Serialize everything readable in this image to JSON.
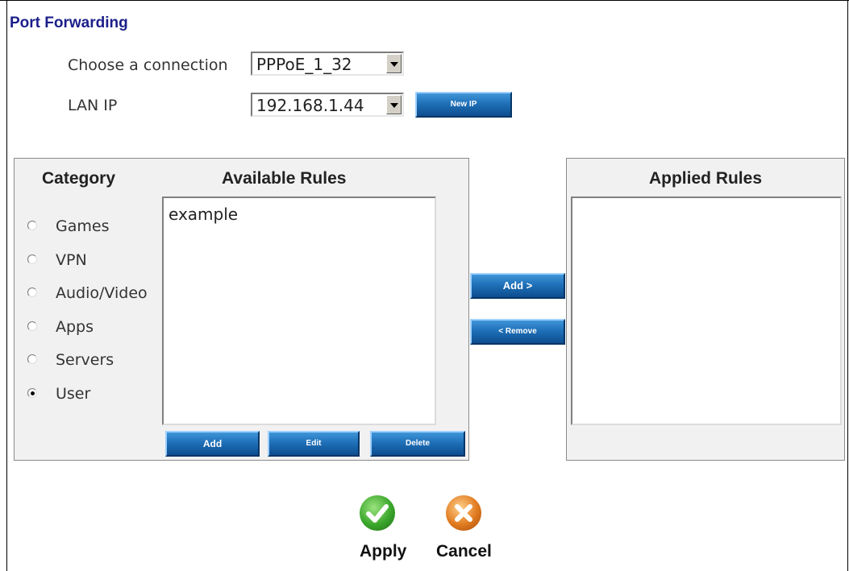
{
  "page": {
    "title": "Port Forwarding"
  },
  "connection": {
    "label": "Choose a connection",
    "value": "PPPoE_1_32"
  },
  "lan": {
    "label": "LAN IP",
    "value": "192.168.1.44",
    "new_ip_button": "New IP"
  },
  "left_panel": {
    "category_heading": "Category",
    "available_heading": "Available Rules",
    "categories": [
      {
        "label": "Games",
        "selected": false
      },
      {
        "label": "VPN",
        "selected": false
      },
      {
        "label": "Audio/Video",
        "selected": false
      },
      {
        "label": "Apps",
        "selected": false
      },
      {
        "label": "Servers",
        "selected": false
      },
      {
        "label": "User",
        "selected": true
      }
    ],
    "available_rules": [
      "example"
    ],
    "buttons": {
      "add": "Add",
      "edit": "Edit",
      "delete": "Delete"
    }
  },
  "transfer": {
    "add": "Add >",
    "remove": "< Remove"
  },
  "right_panel": {
    "heading": "Applied Rules",
    "applied_rules": []
  },
  "footer": {
    "apply": "Apply",
    "cancel": "Cancel"
  },
  "colors": {
    "title": "#1b1f8a",
    "button": "#1f70b8",
    "apply_icon": "#3aa62b",
    "cancel_icon": "#e07a1f"
  },
  "icons": {
    "apply": "check-icon",
    "cancel": "x-icon"
  }
}
